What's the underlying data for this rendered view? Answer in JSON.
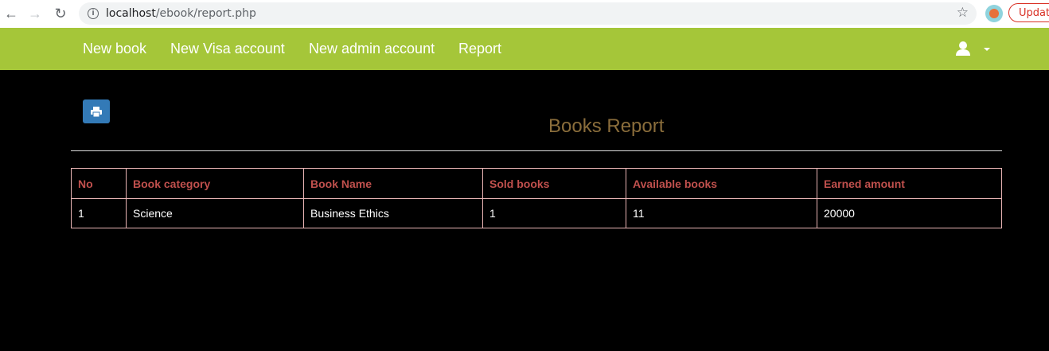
{
  "browser": {
    "url_host": "localhost",
    "url_path": "/ebook/report.php",
    "update_label": "Update"
  },
  "navbar": {
    "links": [
      "New book",
      "New Visa account",
      "New admin account",
      "Report"
    ]
  },
  "report": {
    "title": "Books Report",
    "columns": [
      "No",
      "Book category",
      "Book Name",
      "Sold books",
      "Available books",
      "Earned amount"
    ],
    "rows": [
      [
        "1",
        "Science",
        "Business Ethics",
        "1",
        "11",
        "20000"
      ]
    ]
  }
}
